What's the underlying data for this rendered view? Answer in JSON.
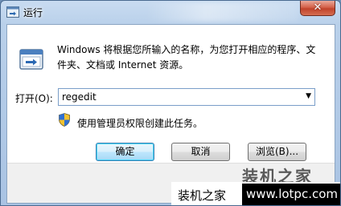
{
  "window": {
    "title": "运行",
    "close_glyph": "✕"
  },
  "dialog": {
    "description": "Windows 将根据您所输入的名称，为您打开相应的程序、文件夹、文档或 Internet 资源。",
    "open_label": "打开(O):",
    "open_value": "regedit",
    "admin_note": "使用管理员权限创建此任务。"
  },
  "buttons": {
    "ok": "确定",
    "cancel": "取消",
    "browse": "浏览(B)..."
  },
  "watermark": {
    "overlay_text": "装机之家",
    "site_name": "装机之家",
    "site_url": "www.lotpc.com"
  },
  "colors": {
    "default_button_border": "#3c7fb1",
    "close_button": "#c0432b"
  }
}
